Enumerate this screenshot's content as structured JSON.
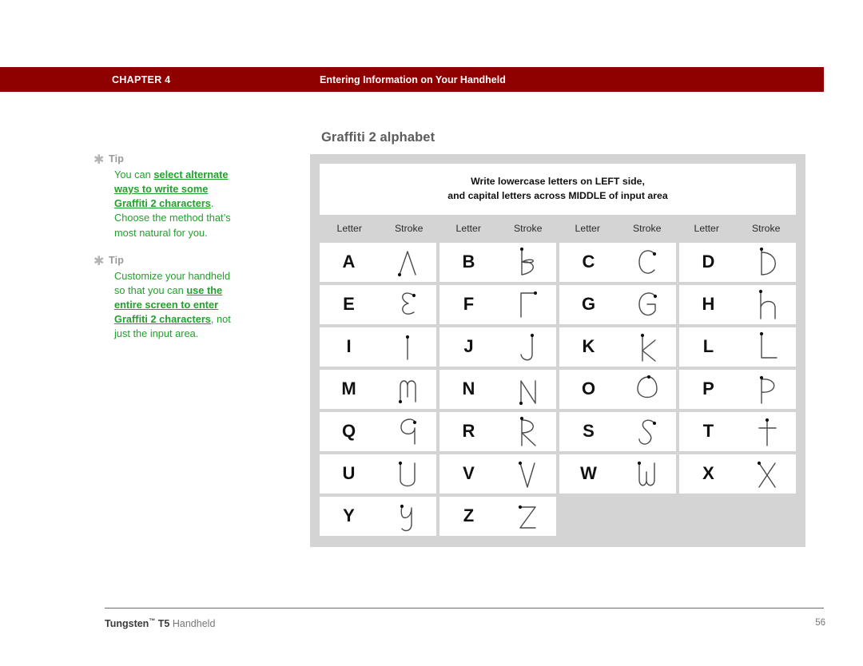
{
  "header": {
    "chapter_label": "CHAPTER 4",
    "chapter_title": "Entering Information on Your Handheld",
    "bar_color": "#8f0000"
  },
  "tips": [
    {
      "icon": "asterisk-icon",
      "label": "Tip",
      "segments": [
        {
          "text": "You can ",
          "link": false
        },
        {
          "text": "select alternate ways to write some Graffiti 2 characters",
          "link": true
        },
        {
          "text": ". Choose the method that’s most natural for you.",
          "link": false
        }
      ]
    },
    {
      "icon": "asterisk-icon",
      "label": "Tip",
      "segments": [
        {
          "text": "Customize your handheld so that you can ",
          "link": false
        },
        {
          "text": "use the entire screen to enter Graffiti 2 characters",
          "link": true
        },
        {
          "text": ", not just the input area.",
          "link": false
        }
      ]
    }
  ],
  "panel": {
    "title": "Graffiti 2 alphabet",
    "note_line1": "Write lowercase letters on LEFT side,",
    "note_line2": "and capital letters across MIDDLE of input area",
    "column_headers": [
      "Letter",
      "Stroke",
      "Letter",
      "Stroke",
      "Letter",
      "Stroke",
      "Letter",
      "Stroke"
    ],
    "rows": [
      [
        "A",
        "B",
        "C",
        "D"
      ],
      [
        "E",
        "F",
        "G",
        "H"
      ],
      [
        "I",
        "J",
        "K",
        "L"
      ],
      [
        "M",
        "N",
        "O",
        "P"
      ],
      [
        "Q",
        "R",
        "S",
        "T"
      ],
      [
        "U",
        "V",
        "W",
        "X"
      ],
      [
        "Y",
        "Z",
        "",
        ""
      ]
    ]
  },
  "footer": {
    "product_bold": "Tungsten",
    "trademark": "™",
    "product_model": " T5 ",
    "product_rest": "Handheld",
    "page_number": "56"
  },
  "colors": {
    "accent_red": "#8f0000",
    "tip_green": "#22a02c",
    "panel_gray": "#d4d4d4",
    "title_gray": "#5c5c5c"
  }
}
